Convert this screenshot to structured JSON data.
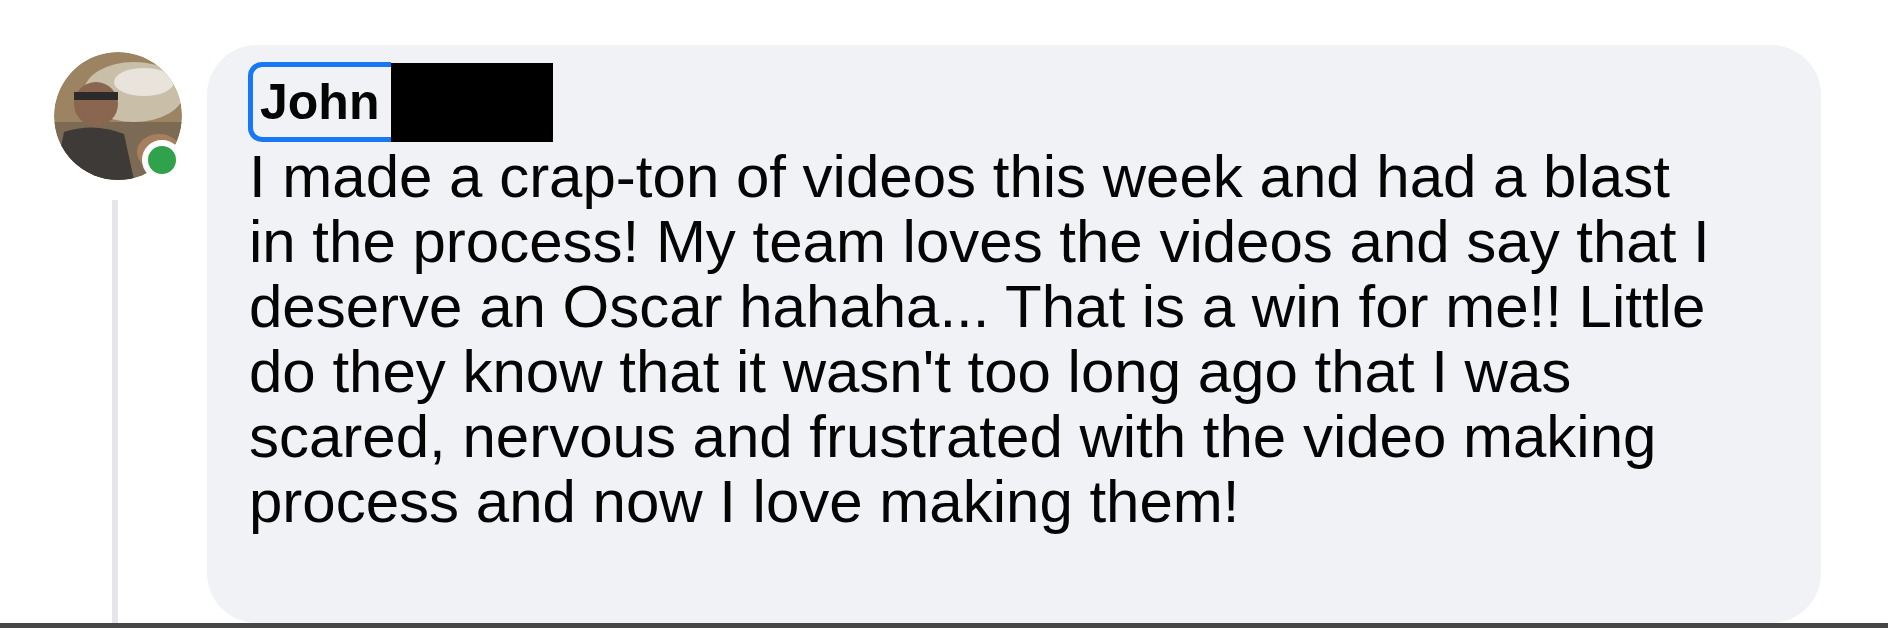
{
  "comment": {
    "author": "John",
    "author_focused": true,
    "online": true,
    "text_lines": [
      "I made a crap-ton of videos this week and had a blast",
      "in the process! My team loves the videos and say that I",
      "deserve an Oscar hahaha... That is a win for me!! Little",
      "do they know that it wasn't too long ago that I was",
      "scared, nervous and frustrated with the video making",
      "process and now I love making them!"
    ]
  }
}
